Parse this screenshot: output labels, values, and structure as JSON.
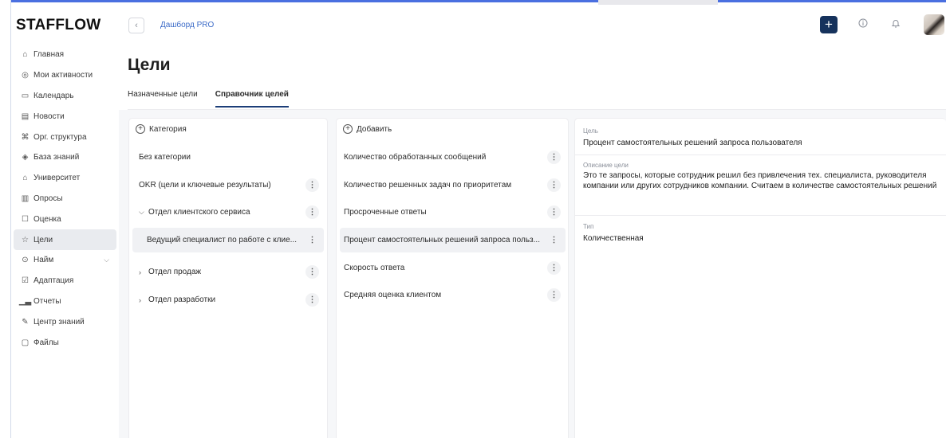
{
  "app": {
    "logo": "STAFFLOW"
  },
  "sidebar": {
    "items": [
      {
        "label": "Главная",
        "icon": "home-icon"
      },
      {
        "label": "Мои активности",
        "icon": "activity-icon"
      },
      {
        "label": "Календарь",
        "icon": "calendar-icon"
      },
      {
        "label": "Новости",
        "icon": "news-icon"
      },
      {
        "label": "Орг. структура",
        "icon": "org-structure-icon"
      },
      {
        "label": "База знаний",
        "icon": "knowledge-base-icon"
      },
      {
        "label": "Университет",
        "icon": "university-icon"
      },
      {
        "label": "Опросы",
        "icon": "survey-icon"
      },
      {
        "label": "Оценка",
        "icon": "assessment-icon"
      },
      {
        "label": "Цели",
        "icon": "star-icon",
        "active": true
      },
      {
        "label": "Найм",
        "icon": "hiring-icon",
        "expandable": true
      },
      {
        "label": "Адаптация",
        "icon": "adaptation-icon"
      },
      {
        "label": "Отчеты",
        "icon": "reports-icon"
      },
      {
        "label": "Центр знаний",
        "icon": "edit-icon"
      },
      {
        "label": "Файлы",
        "icon": "folder-icon"
      }
    ]
  },
  "header": {
    "breadcrumb": "Дашборд PRO",
    "accent_color": "#16325c",
    "link_color": "#3d6cc8"
  },
  "page": {
    "title": "Цели",
    "tabs": [
      {
        "label": "Назначенные цели",
        "active": false
      },
      {
        "label": "Справочник целей",
        "active": true
      }
    ]
  },
  "categories": {
    "add_label": "Категория",
    "items": [
      {
        "label": "Без категории",
        "kebab": false
      },
      {
        "label": "OKR (цели и ключевые результаты)",
        "kebab": true
      },
      {
        "label": "Отдел клиентского сервиса",
        "kebab": true,
        "toggle": "expanded"
      },
      {
        "label": "Ведущий специалист по работе с клие...",
        "kebab": true,
        "selected": true,
        "child": true
      },
      {
        "label": "Отдел продаж",
        "kebab": true,
        "toggle": "collapsed"
      },
      {
        "label": "Отдел разработки",
        "kebab": true,
        "toggle": "collapsed"
      }
    ]
  },
  "goals": {
    "add_label": "Добавить",
    "items": [
      {
        "label": "Количество обработанных сообщений"
      },
      {
        "label": "Количество решенных задач по приоритетам"
      },
      {
        "label": "Просроченные ответы"
      },
      {
        "label": "Процент самостоятельных решений запроса польз...",
        "selected": true
      },
      {
        "label": "Скорость ответа"
      },
      {
        "label": "Средняя оценка клиентом"
      }
    ]
  },
  "details": {
    "goal_label": "Цель",
    "goal_value": "Процент самостоятельных решений запроса пользователя",
    "description_label": "Описание цели",
    "description_value": "Это те запросы, которые сотрудник решил без привлечения тех. специалиста, руководителя компании или других сотрудников компании. Считаем в количестве самостоятельных решений",
    "type_label": "Тип",
    "type_value": "Количественная"
  }
}
